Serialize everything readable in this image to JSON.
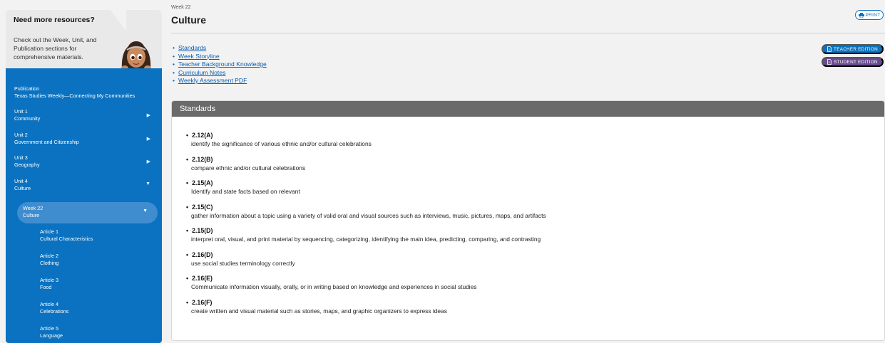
{
  "sidebar": {
    "help": {
      "title": "Need more resources?",
      "text": "Check out the Week, Unit, and Publication sections for comprehensive materials."
    },
    "publication": {
      "label": "Publication",
      "name": "Texas Studies Weekly—Connecting My Communities"
    },
    "units": [
      {
        "label": "Unit 1",
        "name": "Community",
        "expanded": false
      },
      {
        "label": "Unit 2",
        "name": "Government and Citizenship",
        "expanded": false
      },
      {
        "label": "Unit 3",
        "name": "Geography",
        "expanded": false
      },
      {
        "label": "Unit 4",
        "name": "Culture",
        "expanded": true
      }
    ],
    "week": {
      "label": "Week 22",
      "name": "Culture"
    },
    "articles": [
      {
        "label": "Article 1",
        "name": "Cultural Characteristics"
      },
      {
        "label": "Article 2",
        "name": "Clothing"
      },
      {
        "label": "Article 3",
        "name": "Food"
      },
      {
        "label": "Article 4",
        "name": "Celebrations"
      },
      {
        "label": "Article 5",
        "name": "Language"
      }
    ]
  },
  "header": {
    "eyebrow": "Week 22",
    "title": "Culture",
    "print_label": "PRINT"
  },
  "links": [
    "Standards",
    "Week Storyline",
    "Teacher Background Knowledge",
    "Curriculum Notes",
    "Weekly Assessment PDF"
  ],
  "editions": {
    "teacher": "TEACHER EDITION",
    "student": "STUDENT EDITION"
  },
  "standards_panel": {
    "title": "Standards",
    "items": [
      {
        "code": "2.12(A)",
        "desc": "identify the significance of various ethnic and/or cultural celebrations"
      },
      {
        "code": "2.12(B)",
        "desc": "compare ethnic and/or cultural celebrations"
      },
      {
        "code": "2.15(A)",
        "desc": "Identify and state facts based on relevant"
      },
      {
        "code": "2.15(C)",
        "desc": "gather information about a topic using a variety of valid oral and visual sources such as interviews, music, pictures, maps, and artifacts"
      },
      {
        "code": "2.15(D)",
        "desc": "interpret oral, visual, and print material by sequencing, categorizing, identifying the main idea, predicting, comparing, and contrasting"
      },
      {
        "code": "2.16(D)",
        "desc": "use social studies terminology correctly"
      },
      {
        "code": "2.16(E)",
        "desc": "Communicate information visually, orally, or in writing based on knowledge and experiences in social studies"
      },
      {
        "code": "2.16(F)",
        "desc": "create written and visual material such as stories, maps, and graphic organizers to express ideas"
      }
    ]
  },
  "colors": {
    "sidebar_blue": "#0a72c0",
    "active_week": "#3f8dcf",
    "student_purple": "#6a4a8e",
    "panel_header": "#6a6a6a"
  },
  "icons": {
    "print": "printer-icon",
    "edition": "document-icon",
    "collapsed": "chevron-right-icon",
    "expanded": "chevron-down-icon",
    "mascot": "mascot-girl-illustration"
  }
}
